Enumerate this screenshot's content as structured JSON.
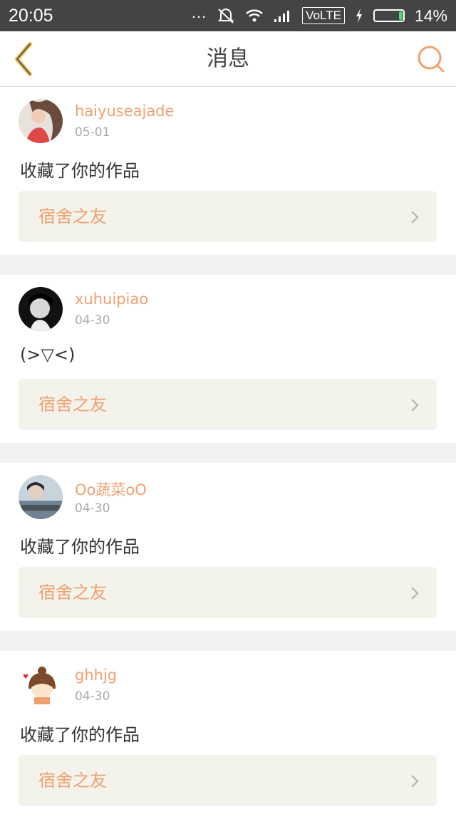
{
  "status_bar": {
    "time": "20:05",
    "dots": "...",
    "network": "VoLTE",
    "battery_percent": "14%",
    "battery_level": 0.14,
    "icons": [
      "dots-icon",
      "mute-icon",
      "wifi-icon",
      "signal-icon",
      "volte-badge",
      "charging-icon",
      "battery-icon"
    ]
  },
  "header": {
    "title": "消息",
    "back_icon": "back-arrow-icon",
    "search_icon": "search-icon",
    "accent_color": "#f0a070"
  },
  "messages": [
    {
      "username": "haiyuseajade",
      "date": "05-01",
      "content": "收藏了你的作品",
      "work_title": "宿舍之友"
    },
    {
      "username": "xuhuipiao",
      "date": "04-30",
      "content": "(>▽<)",
      "work_title": "宿舍之友"
    },
    {
      "username": "Oo蔬菜oO",
      "date": "04-30",
      "content": "收藏了你的作品",
      "work_title": "宿舍之友"
    },
    {
      "username": "ghhjg",
      "date": "04-30",
      "content": "收藏了你的作品",
      "work_title": "宿舍之友"
    }
  ]
}
